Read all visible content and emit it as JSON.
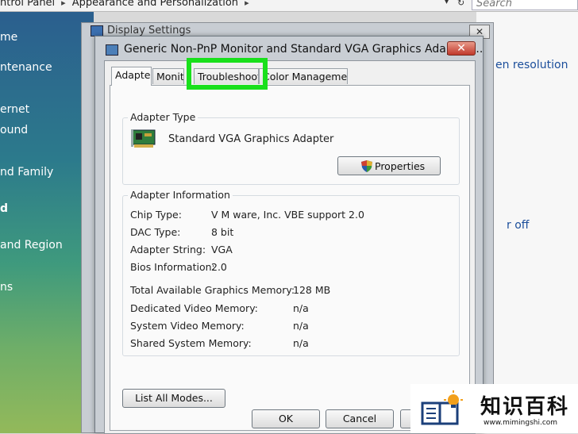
{
  "control_panel": {
    "breadcrumb": [
      "ntrol Panel",
      "Appearance and Personalization"
    ],
    "search_placeholder": "Search",
    "sidebar_items": [
      "me",
      "ntenance",
      "ernet",
      "ound",
      "nd Family",
      "d",
      "and Region",
      "ns"
    ],
    "right_links": [
      "en resolution",
      "r off"
    ]
  },
  "display_settings": {
    "title": "Display Settings",
    "close_label": "✕"
  },
  "dialog": {
    "title": "Generic Non-PnP Monitor and Standard VGA Graphics Adapter ...",
    "close_label": "✕",
    "tabs": [
      "Adapter",
      "Monitor",
      "Troubleshoot",
      "Color Management"
    ],
    "adapter_type": {
      "label": "Adapter Type",
      "name": "Standard VGA Graphics Adapter",
      "properties_button": "Properties"
    },
    "adapter_info": {
      "label": "Adapter Information",
      "rows": [
        {
          "label": "Chip Type:",
          "value": "V M ware, Inc. VBE support 2.0"
        },
        {
          "label": "DAC Type:",
          "value": "8 bit"
        },
        {
          "label": "Adapter String:",
          "value": "VGA"
        },
        {
          "label": "Bios Information:",
          "value": "2.0"
        }
      ],
      "memory_rows": [
        {
          "label": "Total Available Graphics Memory:",
          "value": "128 MB"
        },
        {
          "label": "Dedicated Video Memory:",
          "value": "n/a"
        },
        {
          "label": "System Video Memory:",
          "value": "n/a"
        },
        {
          "label": "Shared System Memory:",
          "value": "n/a"
        }
      ]
    },
    "list_all_modes_button": "List All Modes...",
    "footer_buttons": {
      "ok": "OK",
      "cancel": "Cancel",
      "apply": ""
    }
  },
  "highlight_color": "#19e01c",
  "watermark": {
    "brand": "知识百科",
    "url": "www.mimingshi.com"
  }
}
